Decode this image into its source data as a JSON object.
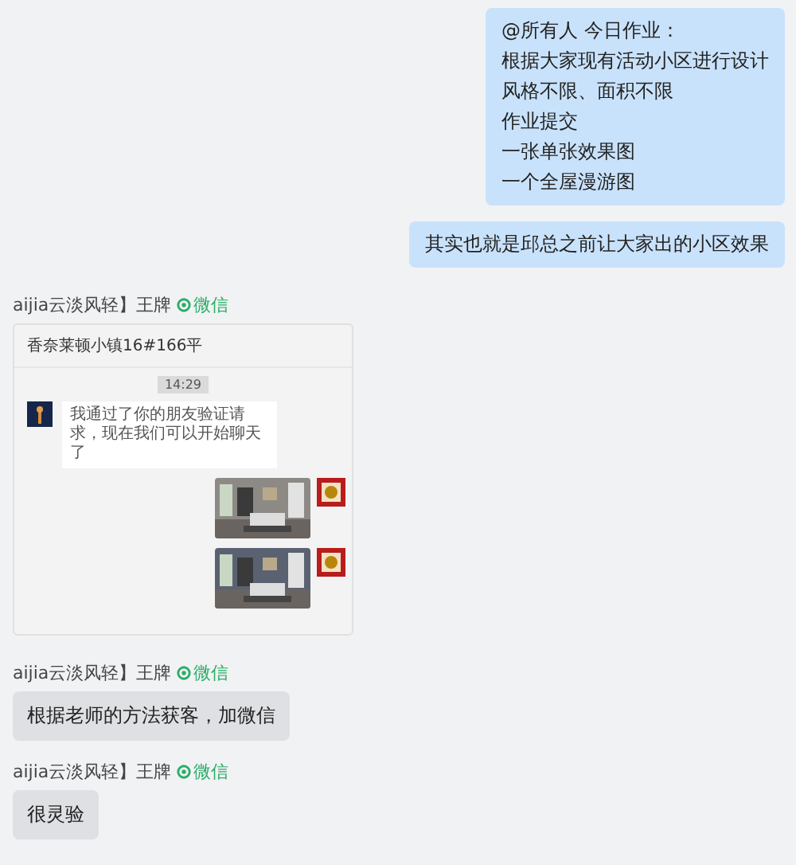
{
  "messages": [
    {
      "kind": "sent",
      "lines": [
        "@所有人  今日作业：",
        "根据大家现有活动小区进行设计",
        "风格不限、面积不限",
        "作业提交",
        "一张单张效果图",
        "一个全屋漫游图"
      ]
    },
    {
      "kind": "sent",
      "lines": [
        "其实也就是邱总之前让大家出的小区效果"
      ]
    },
    {
      "kind": "received",
      "sender": "aijia云淡风轻】王牌",
      "source": "微信",
      "content": {
        "kind": "screenshot",
        "title": "香奈莱顿小镇16#166平",
        "time": "14:29",
        "greeting": "我通过了你的朋友验证请求，现在我们可以开始聊天了"
      }
    },
    {
      "kind": "received",
      "sender": "aijia云淡风轻】王牌",
      "source": "微信",
      "content": {
        "kind": "text",
        "text": "根据老师的方法获客，加微信"
      }
    },
    {
      "kind": "received",
      "sender": "aijia云淡风轻】王牌",
      "source": "微信",
      "content": {
        "kind": "text",
        "text": "很灵验"
      }
    }
  ]
}
